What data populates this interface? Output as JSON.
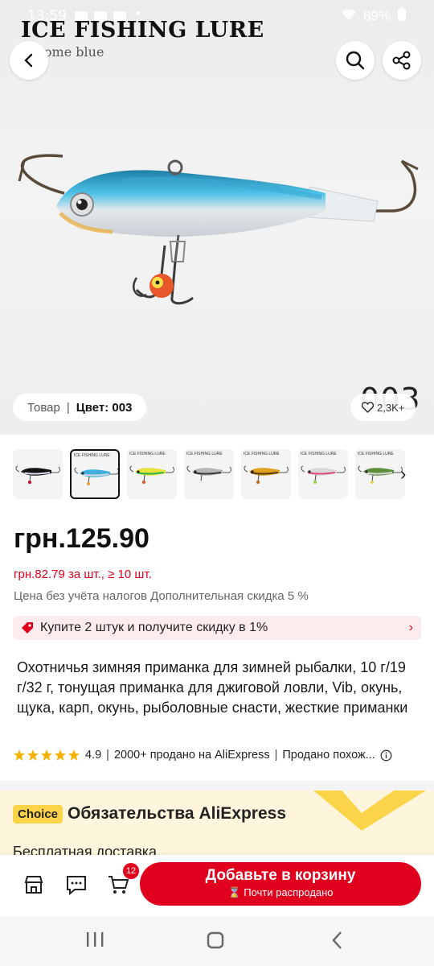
{
  "status_bar": {
    "time": "13:59",
    "battery": "89%"
  },
  "hero": {
    "brand_title": "ICE FISHING LURE",
    "brand_subtitle": "chrome blue",
    "color_label": "Товар",
    "color_value": "Цвет: 003",
    "big_color_code": "003",
    "likes": "2,3K+"
  },
  "thumbnails": [
    {
      "label": "",
      "colors": [
        "#111",
        "#dde",
        "#c02"
      ]
    },
    {
      "label": "ICE FISHING LURE",
      "colors": [
        "#3fb0e0",
        "#cfd8dc",
        "#e8a33d"
      ],
      "selected": true
    },
    {
      "label": "ICE FISHING LURE",
      "colors": [
        "#e9e23a",
        "#2bb24c",
        "#e05a1a"
      ]
    },
    {
      "label": "ICE FISHING LURE",
      "colors": [
        "#b6b6b6",
        "#3a3a3a",
        "#e8e8e8"
      ]
    },
    {
      "label": "ICE FISHING LURE",
      "colors": [
        "#e0a020",
        "#5a3a10",
        "#c2681c"
      ]
    },
    {
      "label": "ICE FISHING LURE",
      "colors": [
        "#d9d9d9",
        "#e24a7a",
        "#9ad34a"
      ]
    },
    {
      "label": "ICE FISHING LURE",
      "colors": [
        "#5c8d3a",
        "#d9d9d9",
        "#e8d24a"
      ]
    }
  ],
  "product": {
    "price": "грн.125.90",
    "bulk_price": "грн.82.79 за шт., ≥ 10 шт.",
    "tax_note": "Цена без учёта налогов Дополнительная скидка 5 %",
    "promo": "Купите 2 штук и получите скидку в 1%",
    "title": "Охотничья зимняя приманка для зимней рыбалки, 10 г/19 г/32 г, тонущая приманка для джиговой ловли, Vib, окунь, щука, карп, окунь, рыболовные снасти, жесткие приманки",
    "rating": "4.9",
    "sold": "2000+ продано на AliExpress",
    "similar": "Продано похож..."
  },
  "choice": {
    "badge": "Choice",
    "title": "Обязательства AliExpress",
    "row2": "Бесплатная доставка"
  },
  "bottom_bar": {
    "cart_count": "12",
    "add_to_cart": "Добавьте в корзину",
    "almost_sold_out": "Почти распродано"
  },
  "colors": {
    "accent": "#e0001e",
    "choice_yellow": "#fbd44a"
  }
}
